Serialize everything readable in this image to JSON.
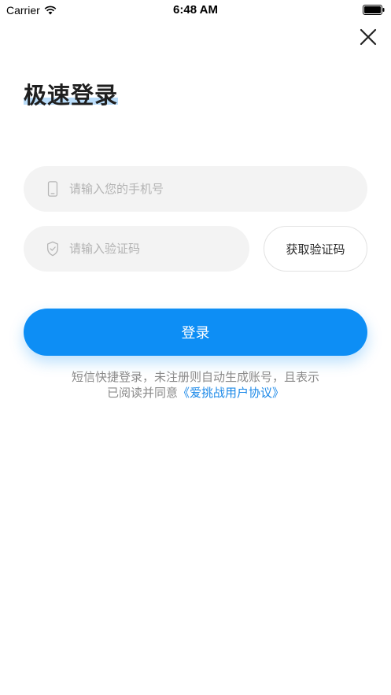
{
  "status_bar": {
    "carrier": "Carrier",
    "time": "6:48 AM"
  },
  "header": {
    "close_icon": "close-icon",
    "title": "极速登录"
  },
  "form": {
    "phone_placeholder": "请输入您的手机号",
    "phone_value": "",
    "phone_icon": "phone-icon",
    "code_placeholder": "请输入验证码",
    "code_value": "",
    "code_icon": "shield-check-icon",
    "get_code_label": "获取验证码",
    "login_label": "登录"
  },
  "agreement": {
    "line1": "短信快捷登录，未注册则自动生成账号，且表示",
    "line2_prefix": "已阅读并同意",
    "link": "《爱挑战用户协议》"
  },
  "colors": {
    "accent": "#0d8ef5",
    "link": "#1a88e8",
    "field_bg": "#f3f3f3",
    "title_highlight": "#b9dcf9"
  }
}
